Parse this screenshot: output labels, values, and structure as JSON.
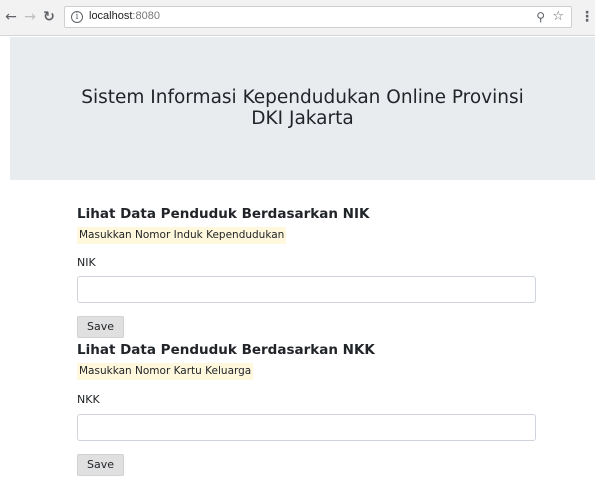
{
  "browser": {
    "url_host": "localhost",
    "url_port": ":8080",
    "icons": {
      "back": "back-arrow-icon",
      "forward": "forward-arrow-icon",
      "reload": "reload-icon",
      "info": "info-icon",
      "zoom": "zoom-icon",
      "bookmark": "star-icon",
      "menu": "kebab-menu-icon"
    }
  },
  "header": {
    "title_line1": "Sistem Informasi Kependudukan Online Provinsi",
    "title_line2": "DKI Jakarta"
  },
  "form_nik": {
    "heading": "Lihat Data Penduduk Berdasarkan NIK",
    "hint": "Masukkan Nomor Induk Kependudukan",
    "label": "NIK",
    "value": "",
    "button_label": "Save"
  },
  "form_nkk": {
    "heading": "Lihat Data Penduduk Berdasarkan NKK",
    "hint": "Masukkan Nomor Kartu Keluarga",
    "label": "NKK",
    "value": "",
    "button_label": "Save"
  },
  "colors": {
    "jumbotron_bg": "#e9ecef",
    "hint_bg": "#fff8dc",
    "button_bg": "#e0e0e0"
  }
}
